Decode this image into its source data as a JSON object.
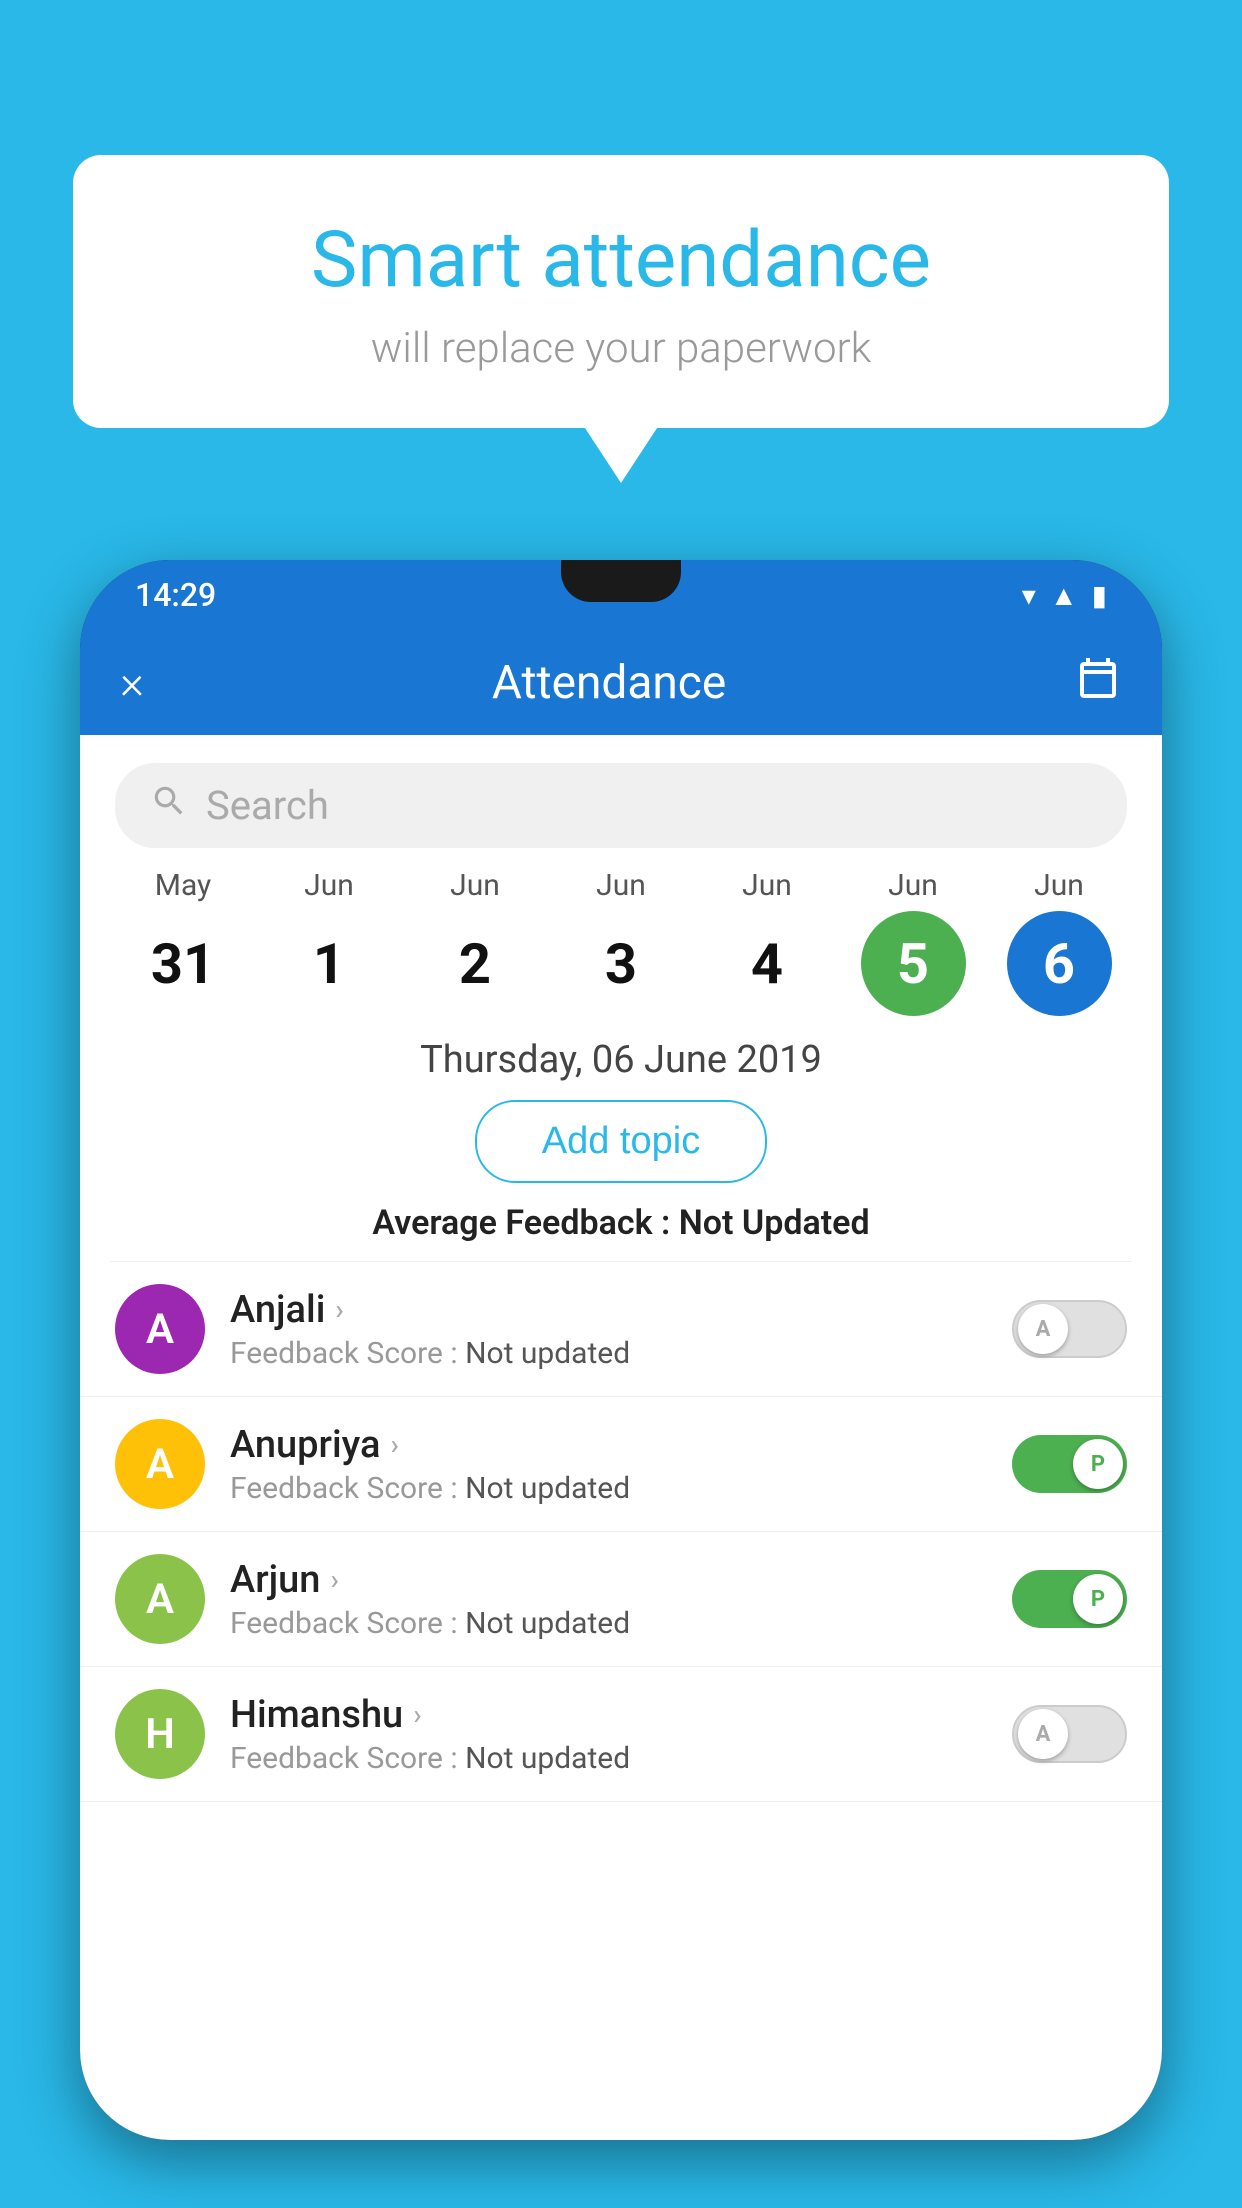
{
  "background_color": "#29b8e8",
  "speech_bubble": {
    "title": "Smart attendance",
    "subtitle": "will replace your paperwork"
  },
  "status_bar": {
    "time": "14:29",
    "icons": [
      "wifi",
      "signal",
      "battery"
    ]
  },
  "header": {
    "title": "Attendance",
    "close_label": "×",
    "calendar_icon": "📅"
  },
  "search": {
    "placeholder": "Search"
  },
  "dates": [
    {
      "month": "May",
      "day": "31",
      "style": "normal"
    },
    {
      "month": "Jun",
      "day": "1",
      "style": "normal"
    },
    {
      "month": "Jun",
      "day": "2",
      "style": "normal"
    },
    {
      "month": "Jun",
      "day": "3",
      "style": "normal"
    },
    {
      "month": "Jun",
      "day": "4",
      "style": "normal"
    },
    {
      "month": "Jun",
      "day": "5",
      "style": "today"
    },
    {
      "month": "Jun",
      "day": "6",
      "style": "selected"
    }
  ],
  "selected_date_label": "Thursday, 06 June 2019",
  "add_topic_label": "Add topic",
  "avg_feedback_label": "Average Feedback : ",
  "avg_feedback_value": "Not Updated",
  "students": [
    {
      "name": "Anjali",
      "avatar_letter": "A",
      "avatar_color": "#9C27B0",
      "feedback_label": "Feedback Score : ",
      "feedback_value": "Not updated",
      "toggle_state": "off",
      "toggle_letter": "A"
    },
    {
      "name": "Anupriya",
      "avatar_letter": "A",
      "avatar_color": "#FFC107",
      "feedback_label": "Feedback Score : ",
      "feedback_value": "Not updated",
      "toggle_state": "on",
      "toggle_letter": "P"
    },
    {
      "name": "Arjun",
      "avatar_letter": "A",
      "avatar_color": "#8BC34A",
      "feedback_label": "Feedback Score : ",
      "feedback_value": "Not updated",
      "toggle_state": "on",
      "toggle_letter": "P"
    },
    {
      "name": "Himanshu",
      "avatar_letter": "H",
      "avatar_color": "#8BC34A",
      "feedback_label": "Feedback Score : ",
      "feedback_value": "Not updated",
      "toggle_state": "off",
      "toggle_letter": "A"
    }
  ]
}
